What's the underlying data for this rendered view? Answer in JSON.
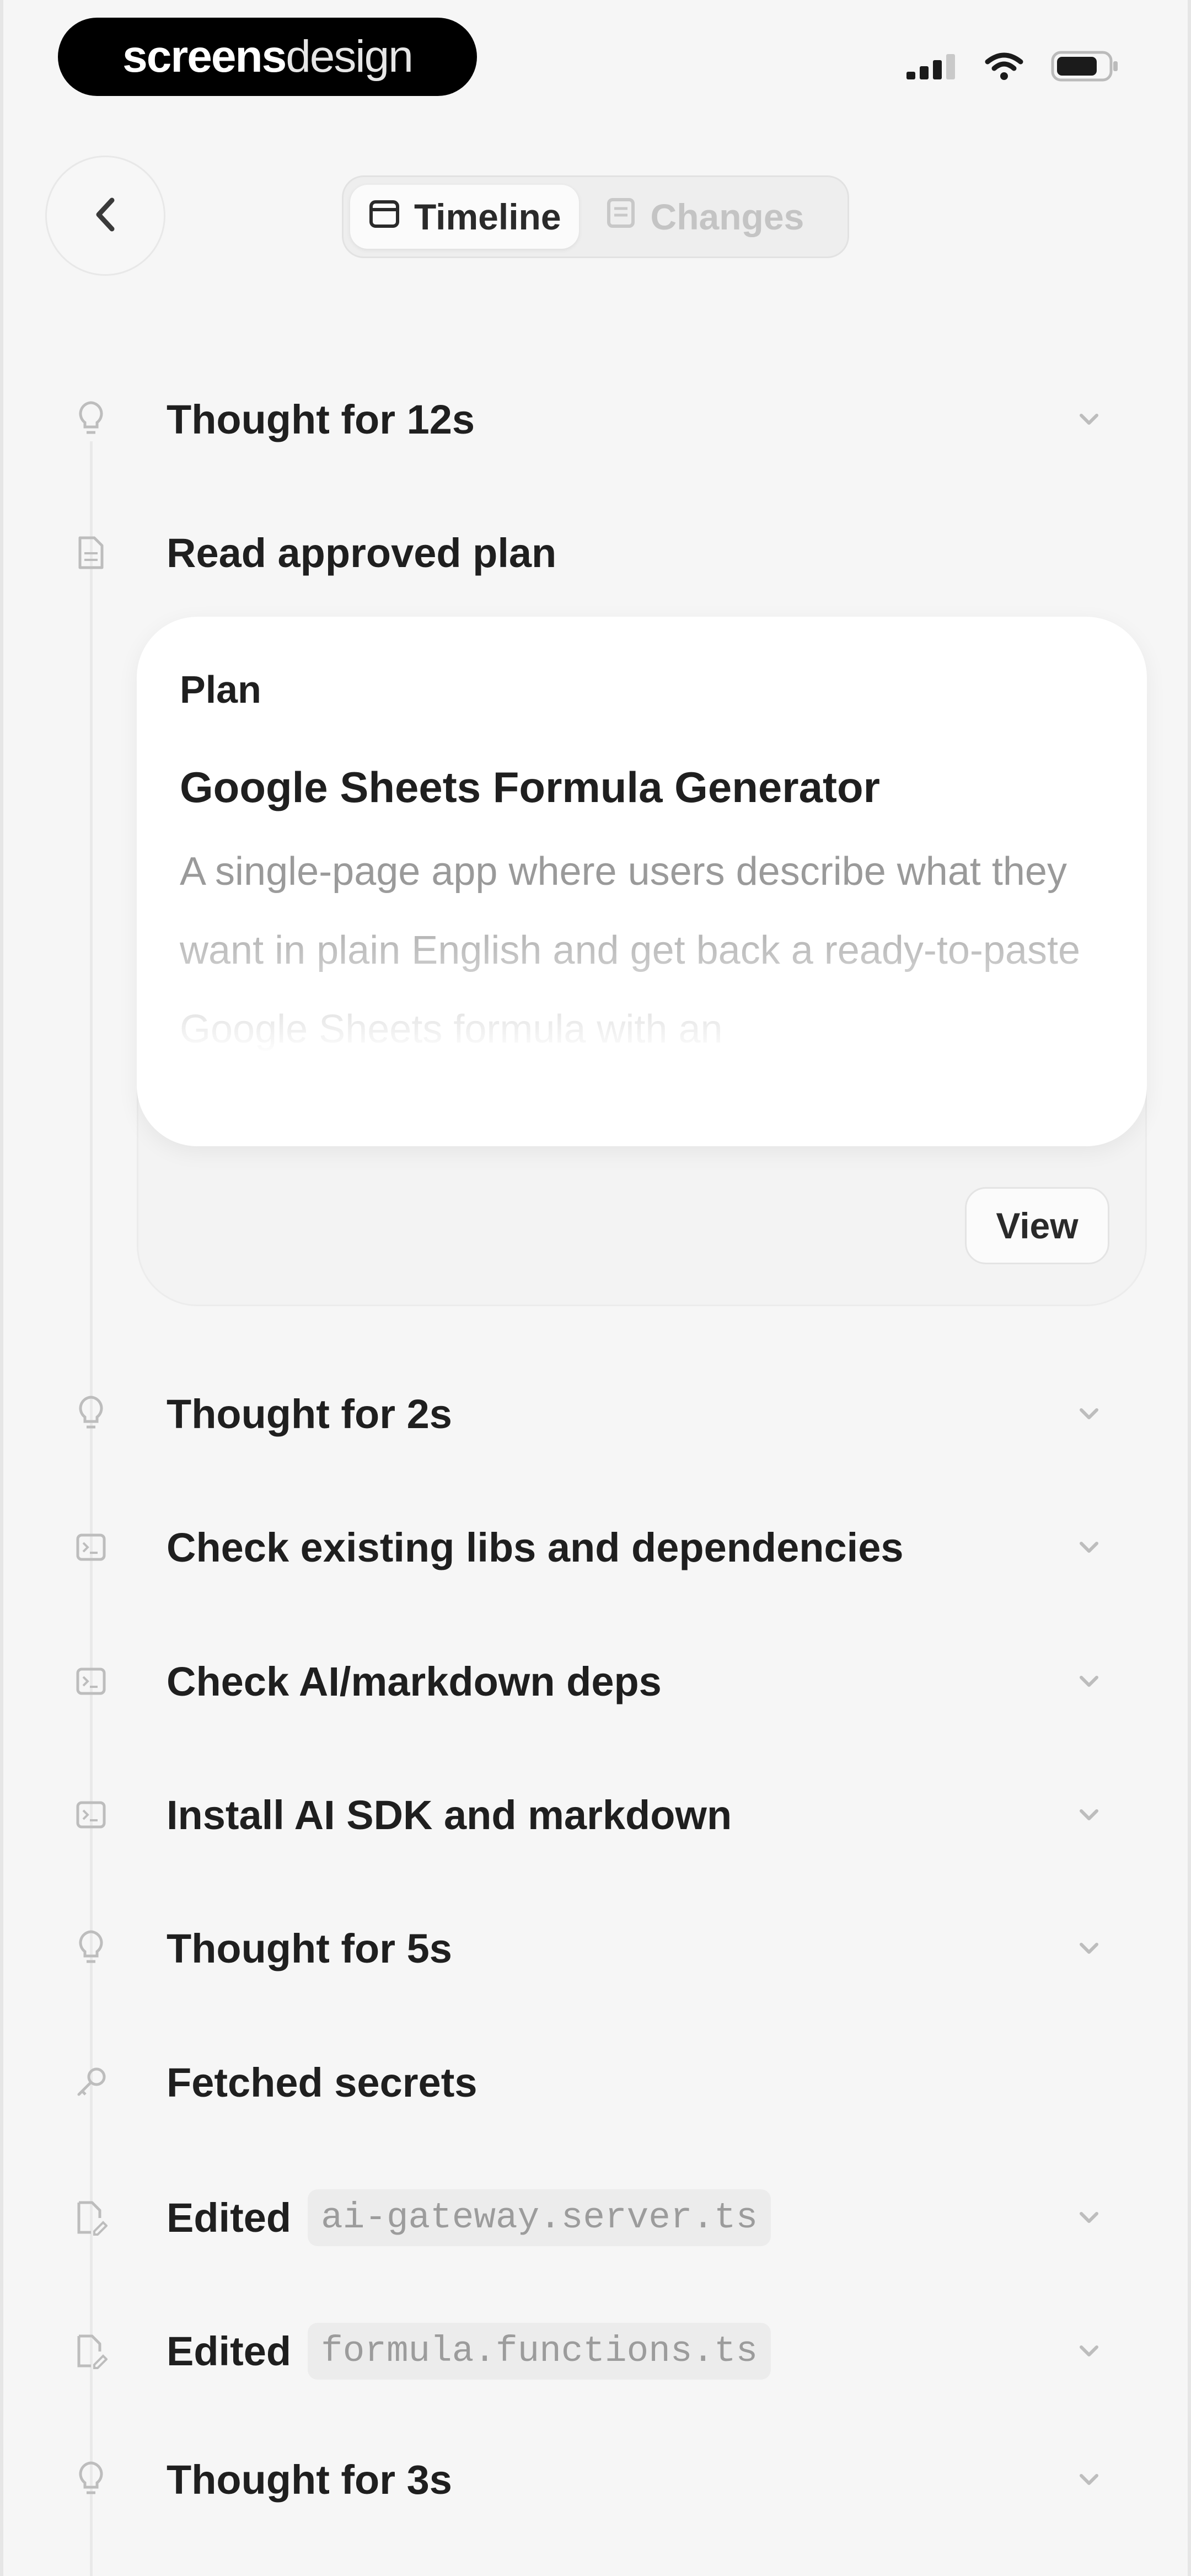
{
  "status_bar": {
    "brand_part1": "screens",
    "brand_part2": "design"
  },
  "header": {
    "tabs": [
      {
        "label": "Timeline",
        "icon": "calendar-icon",
        "active": true
      },
      {
        "label": "Changes",
        "icon": "document-icon",
        "active": false
      }
    ]
  },
  "timeline": {
    "items": [
      {
        "label": "Thought for 12s",
        "icon": "lightbulb-icon",
        "expandable": true
      },
      {
        "label": "Read approved plan",
        "icon": "document-icon",
        "expandable": false
      },
      {
        "label": "Thought for 2s",
        "icon": "lightbulb-icon",
        "expandable": true
      },
      {
        "label": "Check existing libs and dependencies",
        "icon": "terminal-icon",
        "expandable": true
      },
      {
        "label": "Check AI/markdown deps",
        "icon": "terminal-icon",
        "expandable": true
      },
      {
        "label": "Install AI SDK and markdown",
        "icon": "terminal-icon",
        "expandable": true
      },
      {
        "label": "Thought for 5s",
        "icon": "lightbulb-icon",
        "expandable": true
      },
      {
        "label": "Fetched secrets",
        "icon": "key-icon",
        "expandable": false
      },
      {
        "label": "Edited",
        "file": "ai-gateway.server.ts",
        "icon": "file-edit-icon",
        "expandable": true
      },
      {
        "label": "Edited",
        "file": "formula.functions.ts",
        "icon": "file-edit-icon",
        "expandable": true
      },
      {
        "label": "Thought for 3s",
        "icon": "lightbulb-icon",
        "expandable": true
      }
    ]
  },
  "plan_card": {
    "kicker": "Plan",
    "title": "Google Sheets Formula Generator",
    "body": "A single-page app where users describe what they want in plain English and get back a ready-to-paste Google Sheets formula with an",
    "view_label": "View"
  }
}
